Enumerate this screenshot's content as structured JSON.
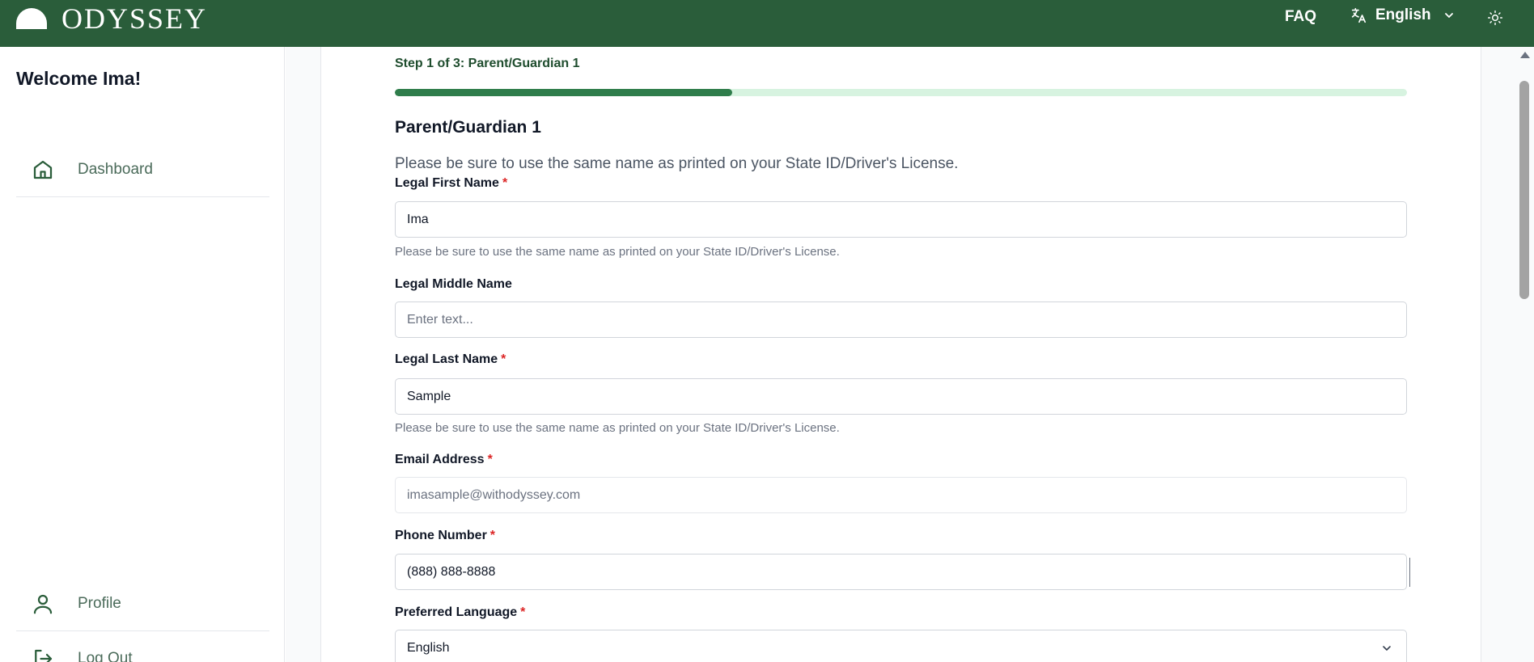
{
  "header": {
    "logo_text": "ODYSSEY",
    "faq_label": "FAQ",
    "language_label": "English",
    "translate_icon": "translate-icon",
    "chevron_icon": "chevron-down-icon",
    "theme_icon": "sun-icon"
  },
  "sidebar": {
    "welcome": "Welcome Ima!",
    "items": [
      {
        "label": "Dashboard",
        "icon": "home-icon"
      },
      {
        "label": "Profile",
        "icon": "user-icon"
      },
      {
        "label": "Log Out",
        "icon": "logout-icon"
      }
    ]
  },
  "form": {
    "step_label": "Step 1 of 3: Parent/Guardian 1",
    "progress_fraction": 0.333,
    "section_title": "Parent/Guardian 1",
    "intro": "Please be sure to use the same name as printed on your State ID/Driver's License.",
    "fields": {
      "first_name": {
        "label": "Legal First Name",
        "value": "Ima",
        "help": "Please be sure to use the same name as printed on your State ID/Driver's License."
      },
      "middle_name": {
        "label": "Legal Middle Name",
        "placeholder": "Enter text..."
      },
      "last_name": {
        "label": "Legal Last Name",
        "value": "Sample",
        "help": "Please be sure to use the same name as printed on your State ID/Driver's License."
      },
      "email": {
        "label": "Email Address",
        "value": "imasample@withodyssey.com"
      },
      "phone": {
        "label": "Phone Number",
        "value": "(888) 888-8888"
      },
      "preferred_language": {
        "label": "Preferred Language",
        "value": "English"
      }
    },
    "required_mark": "*"
  },
  "colors": {
    "brand_green": "#2a5d3a",
    "progress_fill": "#2f7d4b",
    "progress_track": "#d7f3e0",
    "required": "#dc2626"
  }
}
